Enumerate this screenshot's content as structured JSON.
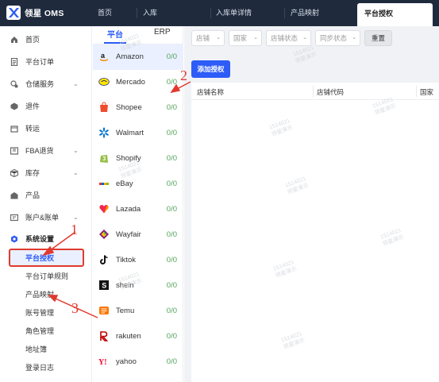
{
  "brand": {
    "name": "领星 OMS"
  },
  "header": {
    "tabs": [
      {
        "label": "首页"
      },
      {
        "label": "入库"
      },
      {
        "label": "入库单详情"
      },
      {
        "label": "产品映射"
      },
      {
        "label": "平台授权"
      }
    ]
  },
  "sidebar": {
    "items": [
      {
        "label": "首页",
        "icon": "home-icon"
      },
      {
        "label": "平台订单",
        "icon": "order-icon"
      },
      {
        "label": "仓储服务",
        "icon": "warehouse-icon"
      },
      {
        "label": "退件",
        "icon": "return-icon"
      },
      {
        "label": "转运",
        "icon": "transfer-icon"
      },
      {
        "label": "FBA退货",
        "icon": "fba-icon"
      },
      {
        "label": "库存",
        "icon": "inventory-icon"
      },
      {
        "label": "产品",
        "icon": "product-icon"
      },
      {
        "label": "账户&账单",
        "icon": "account-icon"
      },
      {
        "label": "系统设置",
        "icon": "settings-icon"
      }
    ],
    "sub_items": [
      {
        "label": "平台授权"
      },
      {
        "label": "平台订单规则"
      },
      {
        "label": "产品映射"
      },
      {
        "label": "账号管理"
      },
      {
        "label": "角色管理"
      },
      {
        "label": "地址簿"
      },
      {
        "label": "登录日志"
      }
    ]
  },
  "platform_panel": {
    "tabs": [
      {
        "label": "平台"
      },
      {
        "label": "ERP"
      }
    ],
    "platforms": [
      {
        "name": "Amazon",
        "count": "0/0"
      },
      {
        "name": "Mercado",
        "count": "0/0"
      },
      {
        "name": "Shopee",
        "count": "0/0"
      },
      {
        "name": "Walmart",
        "count": "0/0"
      },
      {
        "name": "Shopify",
        "count": "0/0"
      },
      {
        "name": "eBay",
        "count": "0/0"
      },
      {
        "name": "Lazada",
        "count": "0/0"
      },
      {
        "name": "Wayfair",
        "count": "0/0"
      },
      {
        "name": "Tiktok",
        "count": "0/0"
      },
      {
        "name": "shein",
        "count": "0/0"
      },
      {
        "name": "Temu",
        "count": "0/0"
      },
      {
        "name": "rakuten",
        "count": "0/0"
      },
      {
        "name": "yahoo",
        "count": "0/0"
      }
    ]
  },
  "filters": {
    "store": "店铺",
    "country": "国家",
    "store_status": "店铺状态",
    "sync_status": "同步状态",
    "reset_label": "重置"
  },
  "actions": {
    "add_auth_label": "添加授权"
  },
  "table": {
    "columns": [
      {
        "label": "店铺名称"
      },
      {
        "label": "店铺代码"
      },
      {
        "label": "国家"
      }
    ]
  },
  "watermark": {
    "line1": "1514021",
    "line2": "领星演示"
  },
  "annotations": {
    "n1": "1",
    "n2": "2",
    "n3": "3"
  },
  "colors": {
    "accent": "#2d5cf6",
    "annotation": "#e03a2f",
    "header_bg": "#1f2b3d"
  }
}
